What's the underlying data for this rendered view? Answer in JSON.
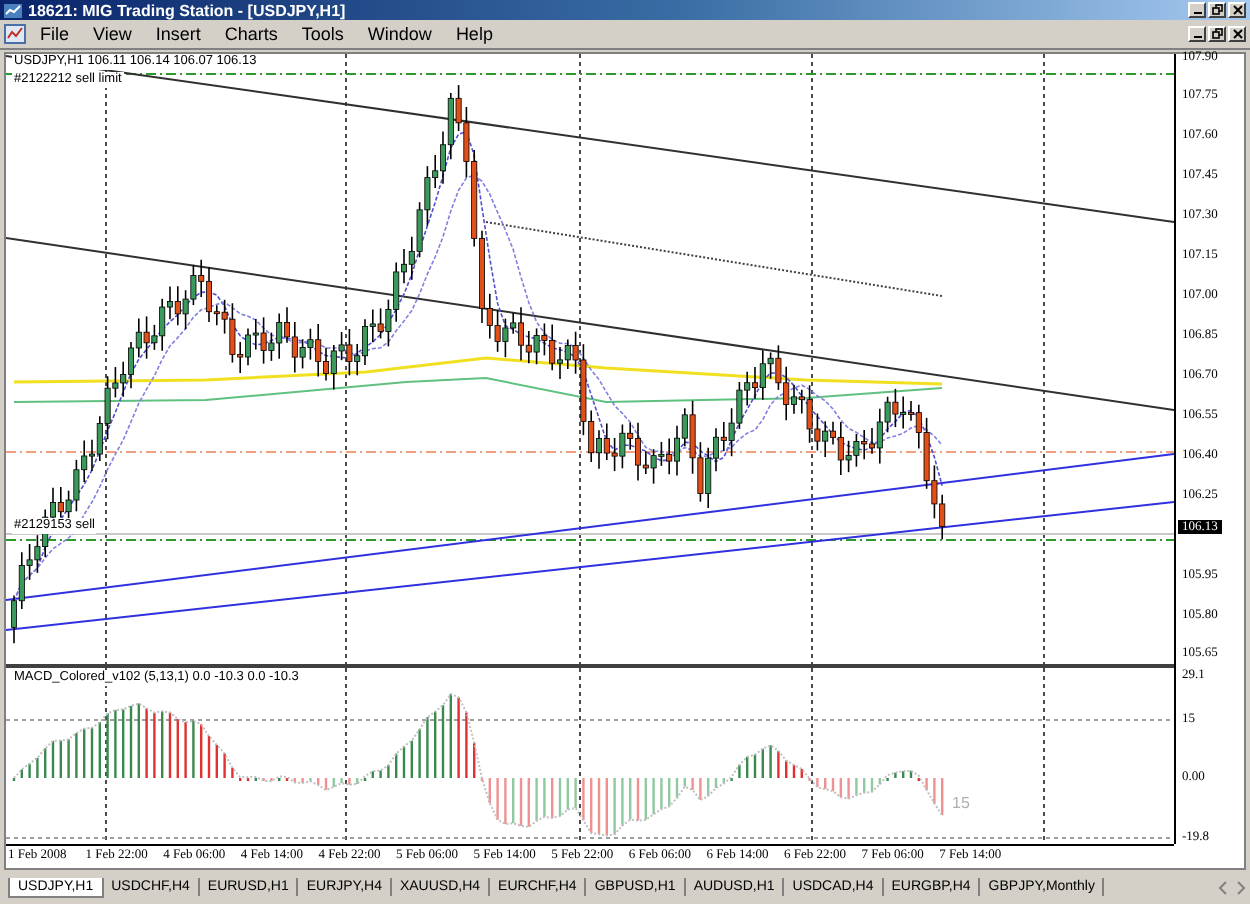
{
  "window": {
    "title": "18621: MIG Trading Station - [USDJPY,H1]"
  },
  "menu": [
    "File",
    "View",
    "Insert",
    "Charts",
    "Tools",
    "Window",
    "Help"
  ],
  "chart": {
    "header": "USDJPY,H1  106.11 106.14 106.07 106.13",
    "orders": [
      {
        "label": "#2122212 sell limit"
      },
      {
        "label": "#2129153 sell"
      }
    ],
    "price_ticks": [
      "107.90",
      "107.75",
      "107.60",
      "107.45",
      "107.30",
      "107.15",
      "107.00",
      "106.85",
      "106.70",
      "106.55",
      "106.40",
      "106.25",
      "105.95",
      "105.80",
      "105.65"
    ],
    "current_price": "106.13",
    "time_labels": [
      "1 Feb 2008",
      "1 Feb 22:00",
      "4 Feb 06:00",
      "4 Feb 14:00",
      "4 Feb 22:00",
      "5 Feb 06:00",
      "5 Feb 14:00",
      "5 Feb 22:00",
      "6 Feb 06:00",
      "6 Feb 14:00",
      "6 Feb 22:00",
      "7 Feb 06:00",
      "7 Feb 14:00"
    ]
  },
  "indicator": {
    "label": "MACD_Colored_v102 (5,13,1) 0.0 -10.3 0.0 -10.3",
    "ticks": [
      "29.1",
      "15",
      "0.00",
      "-19.8"
    ],
    "marker": "15"
  },
  "tabs": [
    {
      "label": "USDJPY,H1",
      "selected": true
    },
    {
      "label": "USDCHF,H4",
      "selected": false
    },
    {
      "label": "EURUSD,H1",
      "selected": false
    },
    {
      "label": "EURJPY,H4",
      "selected": false
    },
    {
      "label": "XAUUSD,H4",
      "selected": false
    },
    {
      "label": "EURCHF,H4",
      "selected": false
    },
    {
      "label": "GBPUSD,H1",
      "selected": false
    },
    {
      "label": "AUDUSD,H1",
      "selected": false
    },
    {
      "label": "USDCAD,H4",
      "selected": false
    },
    {
      "label": "EURGBP,H4",
      "selected": false
    },
    {
      "label": "GBPJPY,Monthly",
      "selected": false
    }
  ]
}
